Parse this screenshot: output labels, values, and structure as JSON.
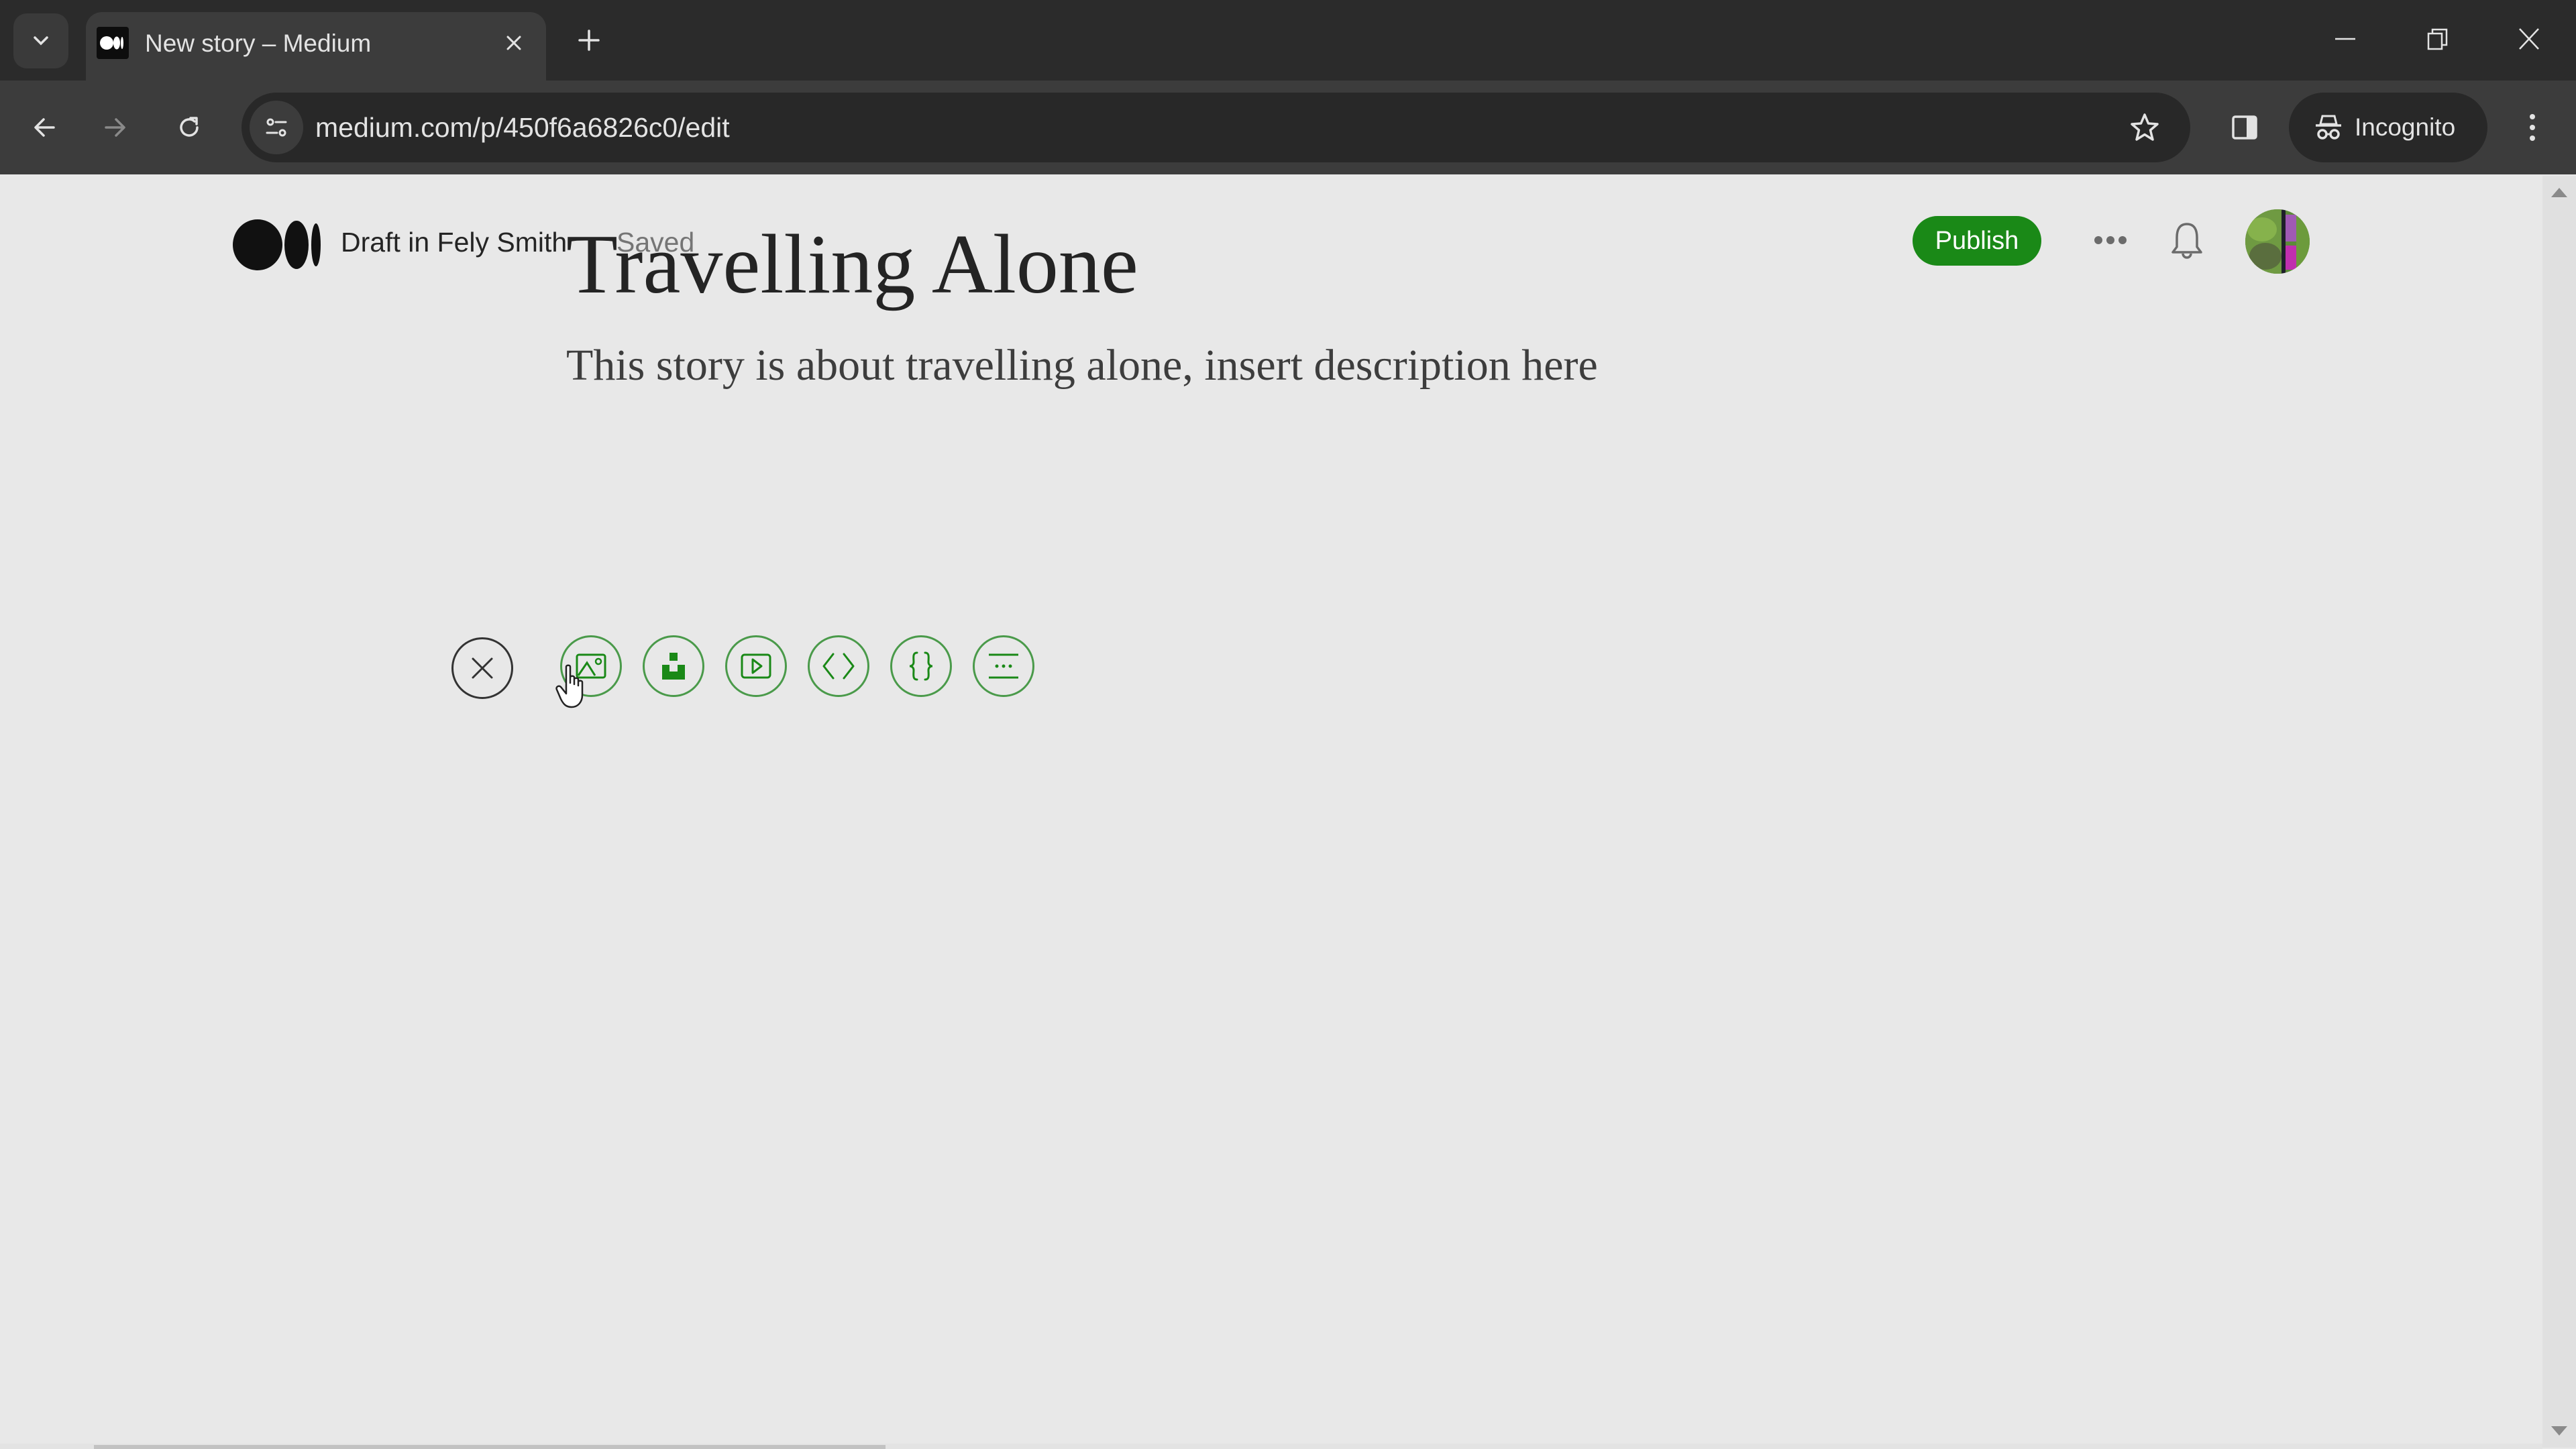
{
  "browser": {
    "tab": {
      "title": "New story – Medium",
      "favicon": "medium-logo-icon"
    },
    "address_bar": {
      "url": "medium.com/p/450f6a6826c0/edit"
    },
    "profile_label": "Incognito",
    "icons": {
      "tab_search": "chevron-down-icon",
      "tab_close": "close-icon",
      "new_tab": "plus-icon",
      "minimize": "minimize-icon",
      "restore": "restore-icon",
      "close_window": "close-icon",
      "back": "arrow-left-icon",
      "forward": "arrow-right-icon",
      "reload": "reload-icon",
      "site_info": "tune-icon",
      "bookmark": "star-icon",
      "side_panel": "side-panel-icon",
      "incognito": "incognito-icon",
      "menu": "kebab-menu-icon"
    }
  },
  "editor_header": {
    "brand": "medium-logo",
    "draft_label": "Draft in Fely Smith",
    "save_status": "Saved",
    "publish_label": "Publish",
    "colors": {
      "publish_bg": "#1a8917",
      "publish_text": "#ffffff",
      "accent_green": "#1a8917"
    }
  },
  "story": {
    "title": "Travelling Alone",
    "subtitle": "This story is about travelling alone, insert description here"
  },
  "insert_menu": {
    "buttons": [
      {
        "name": "close",
        "icon": "close-icon"
      },
      {
        "name": "add-image",
        "icon": "image-icon"
      },
      {
        "name": "add-unsplash-image",
        "icon": "unsplash-icon"
      },
      {
        "name": "add-video",
        "icon": "video-icon"
      },
      {
        "name": "add-embed",
        "icon": "code-icon"
      },
      {
        "name": "add-code-block",
        "icon": "braces-icon"
      },
      {
        "name": "add-new-part",
        "icon": "section-break-icon"
      }
    ]
  }
}
